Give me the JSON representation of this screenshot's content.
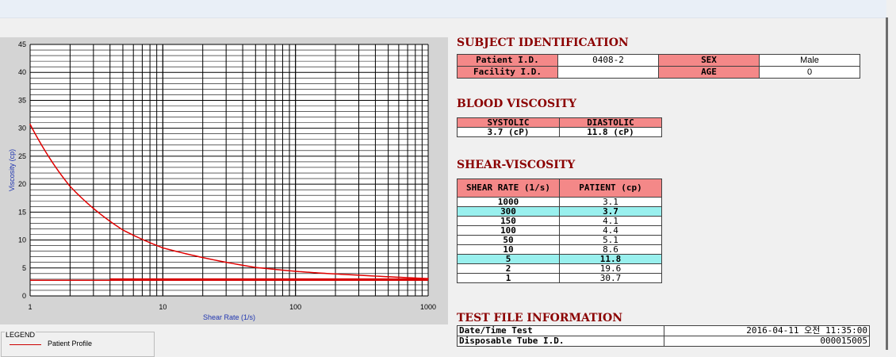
{
  "subject": {
    "heading": "SUBJECT IDENTIFICATION",
    "patient_id_label": "Patient I.D.",
    "patient_id": "0408-2",
    "sex_label": "SEX",
    "sex": "Male",
    "facility_label": "Facility I.D.",
    "facility": "",
    "age_label": "AGE",
    "age": "0"
  },
  "blood": {
    "heading": "BLOOD VISCOSITY",
    "systolic_label": "SYSTOLIC",
    "diastolic_label": "DIASTOLIC",
    "systolic": "3.7 (cP)",
    "diastolic": "11.8 (cP)"
  },
  "shear": {
    "heading": "SHEAR-VISCOSITY",
    "col_rate": "SHEAR RATE (1/s)",
    "col_patient": "PATIENT (cp)",
    "rows": [
      {
        "rate": "1000",
        "value": "3.1",
        "highlight": false
      },
      {
        "rate": "300",
        "value": "3.7",
        "highlight": true
      },
      {
        "rate": "150",
        "value": "4.1",
        "highlight": false
      },
      {
        "rate": "100",
        "value": "4.4",
        "highlight": false
      },
      {
        "rate": "50",
        "value": "5.1",
        "highlight": false
      },
      {
        "rate": "10",
        "value": "8.6",
        "highlight": false
      },
      {
        "rate": "5",
        "value": "11.8",
        "highlight": true
      },
      {
        "rate": "2",
        "value": "19.6",
        "highlight": false
      },
      {
        "rate": "1",
        "value": "30.7",
        "highlight": false
      }
    ]
  },
  "testfile": {
    "heading": "TEST FILE INFORMATION",
    "datetime_label": "Date/Time Test",
    "datetime": "2016-04-11  오전 11:35:00",
    "tube_label": "Disposable Tube I.D.",
    "tube": "000015005"
  },
  "legend": {
    "title": "LEGEND",
    "entry": "Patient Profile"
  },
  "colors": {
    "curve": "#e00000",
    "reference": "#d60000",
    "header": "#f48888",
    "highlight": "#99f0ee"
  },
  "chart_data": {
    "type": "line",
    "xlabel": "Shear Rate (1/s)",
    "ylabel": "Viscosity (cp)",
    "xscale": "log",
    "xlim": [
      1,
      1000
    ],
    "ylim": [
      0,
      45
    ],
    "xticks": [
      1,
      10,
      100,
      1000
    ],
    "yticks": [
      0,
      5,
      10,
      15,
      20,
      25,
      30,
      35,
      40,
      45
    ],
    "grid": true,
    "legend": "bottom-left",
    "series": [
      {
        "name": "Patient Profile",
        "x": [
          1,
          2,
          5,
          10,
          50,
          100,
          150,
          300,
          1000
        ],
        "y": [
          30.7,
          19.6,
          11.8,
          8.6,
          5.1,
          4.4,
          4.1,
          3.7,
          3.1
        ]
      },
      {
        "x": [
          1,
          1000
        ],
        "y": [
          2.8,
          2.8
        ]
      },
      {
        "x": [
          4,
          1000
        ],
        "y": [
          3.0,
          3.0
        ]
      }
    ]
  }
}
